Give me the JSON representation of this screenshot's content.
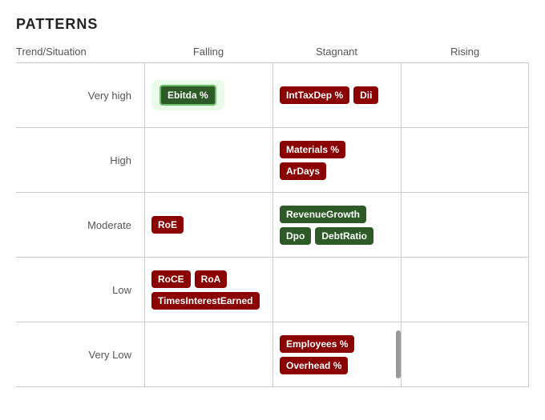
{
  "title": "PATTERNS",
  "headers": {
    "row_label": "Trend/Situation",
    "col1": "Falling",
    "col2": "Stagnant",
    "col3": "Rising"
  },
  "rows": [
    {
      "label": "Very high",
      "falling": [
        {
          "text": "Ebitda %",
          "style": "dark-green",
          "highlight": true
        }
      ],
      "stagnant": [
        {
          "text": "IntTaxDep %",
          "style": "dark-red"
        },
        {
          "text": "Dii",
          "style": "dark-red"
        }
      ],
      "rising": []
    },
    {
      "label": "High",
      "falling": [],
      "stagnant": [
        {
          "text": "Materials %",
          "style": "dark-red"
        },
        {
          "text": "ArDays",
          "style": "dark-red"
        }
      ],
      "rising": []
    },
    {
      "label": "Moderate",
      "falling": [
        {
          "text": "RoE",
          "style": "dark-red"
        }
      ],
      "stagnant": [
        {
          "text": "RevenueGrowth",
          "style": "dark-green"
        },
        {
          "text": "Dpo",
          "style": "dark-green"
        },
        {
          "text": "DebtRatio",
          "style": "dark-green"
        }
      ],
      "rising": []
    },
    {
      "label": "Low",
      "falling": [
        {
          "text": "RoCE",
          "style": "dark-red"
        },
        {
          "text": "RoA",
          "style": "dark-red"
        },
        {
          "text": "TimesInterestEarned",
          "style": "dark-red"
        }
      ],
      "stagnant": [],
      "rising": []
    },
    {
      "label": "Very Low",
      "falling": [],
      "stagnant": [
        {
          "text": "Employees %",
          "style": "dark-red"
        },
        {
          "text": "Overhead %",
          "style": "dark-red"
        }
      ],
      "rising": [],
      "has_bar": true
    }
  ]
}
